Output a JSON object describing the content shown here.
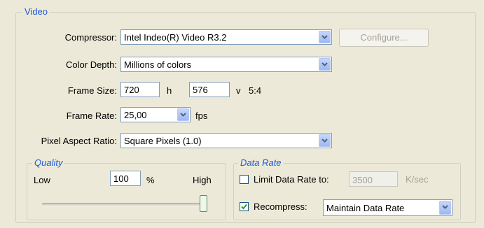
{
  "video": {
    "title": "Video",
    "compressor": {
      "label": "Compressor:",
      "value": "Intel Indeo(R) Video R3.2",
      "configure_label": "Configure..."
    },
    "color_depth": {
      "label": "Color Depth:",
      "value": "Millions of colors"
    },
    "frame_size": {
      "label": "Frame Size:",
      "width": "720",
      "width_unit": "h",
      "height": "576",
      "height_unit": "v",
      "ratio": "5:4"
    },
    "frame_rate": {
      "label": "Frame Rate:",
      "value": "25,00",
      "unit": "fps"
    },
    "pixel_aspect": {
      "label": "Pixel Aspect Ratio:",
      "value": "Square Pixels (1.0)"
    }
  },
  "quality": {
    "title": "Quality",
    "low_label": "Low",
    "high_label": "High",
    "value": "100",
    "unit": "%",
    "slider_level": 1.0
  },
  "data_rate": {
    "title": "Data Rate",
    "limit_label": "Limit Data Rate to:",
    "limit_checked": false,
    "limit_value": "3500",
    "limit_unit": "K/sec",
    "recompress_label": "Recompress:",
    "recompress_checked": true,
    "recompress_value": "Maintain Data Rate"
  },
  "colors": {
    "group_title": "#1d5ad6",
    "disabled_text": "#a5a297"
  }
}
